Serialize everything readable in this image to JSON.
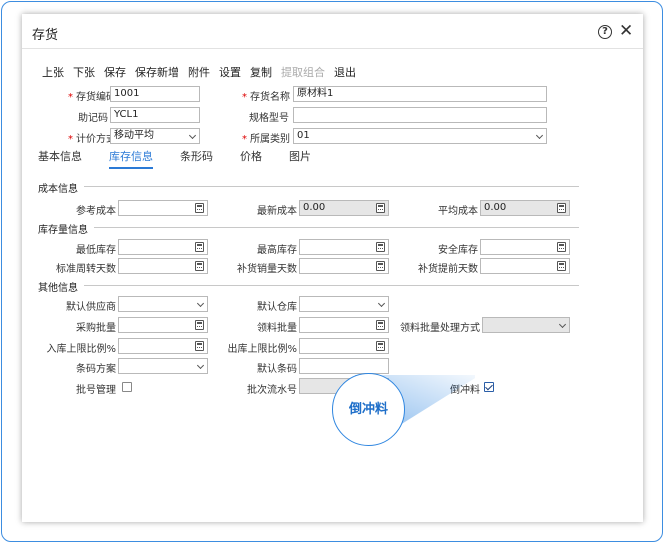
{
  "dialog": {
    "title": "存货"
  },
  "toolbar": [
    "上张",
    "下张",
    "保存",
    "保存新增",
    "附件",
    "设置",
    "复制",
    "提取组合",
    "退出"
  ],
  "header_fields": {
    "code": {
      "label": "存货编码",
      "value": "1001"
    },
    "name": {
      "label": "存货名称",
      "value": "原材料1"
    },
    "mnemonic": {
      "label": "助记码",
      "value": "YCL1"
    },
    "spec": {
      "label": "规格型号",
      "value": ""
    },
    "valuation": {
      "label": "计价方式",
      "value": "移动平均"
    },
    "category": {
      "label": "所属类别",
      "value": "01"
    }
  },
  "tabs": [
    "基本信息",
    "库存信息",
    "条形码",
    "价格",
    "图片"
  ],
  "sections": {
    "cost": "成本信息",
    "stock": "库存量信息",
    "other": "其他信息"
  },
  "cost": {
    "ref_cost": {
      "label": "参考成本",
      "value": ""
    },
    "latest_cost": {
      "label": "最新成本",
      "value": "0.00"
    },
    "avg_cost": {
      "label": "平均成本",
      "value": "0.00"
    }
  },
  "stock": {
    "min": {
      "label": "最低库存",
      "value": ""
    },
    "max": {
      "label": "最高库存",
      "value": ""
    },
    "safe": {
      "label": "安全库存",
      "value": ""
    },
    "turnover": {
      "label": "标准周转天数",
      "value": ""
    },
    "replenish_days": {
      "label": "补货销量天数",
      "value": ""
    },
    "lead_days": {
      "label": "补货提前天数",
      "value": ""
    }
  },
  "other": {
    "supplier": {
      "label": "默认供应商",
      "value": ""
    },
    "warehouse": {
      "label": "默认仓库",
      "value": ""
    },
    "purchase_batch": {
      "label": "采购批量",
      "value": ""
    },
    "pick_batch": {
      "label": "领料批量",
      "value": ""
    },
    "pick_method": {
      "label": "领料批量处理方式",
      "value": ""
    },
    "in_limit": {
      "label": "入库上限比例%",
      "value": ""
    },
    "out_limit": {
      "label": "出库上限比例%",
      "value": ""
    },
    "barcode_plan": {
      "label": "条码方案",
      "value": ""
    },
    "default_barcode": {
      "label": "默认条码",
      "value": ""
    },
    "batch_mgmt": {
      "label": "批号管理",
      "checked": false
    },
    "batch_serial": {
      "label": "批次流水号",
      "value": ""
    },
    "backflush": {
      "label": "倒冲料",
      "checked": true
    }
  },
  "callout": {
    "text": "倒冲料"
  },
  "colors": {
    "accent": "#2b7ad6",
    "frame": "#3d8de0",
    "required": "#dd0000"
  }
}
